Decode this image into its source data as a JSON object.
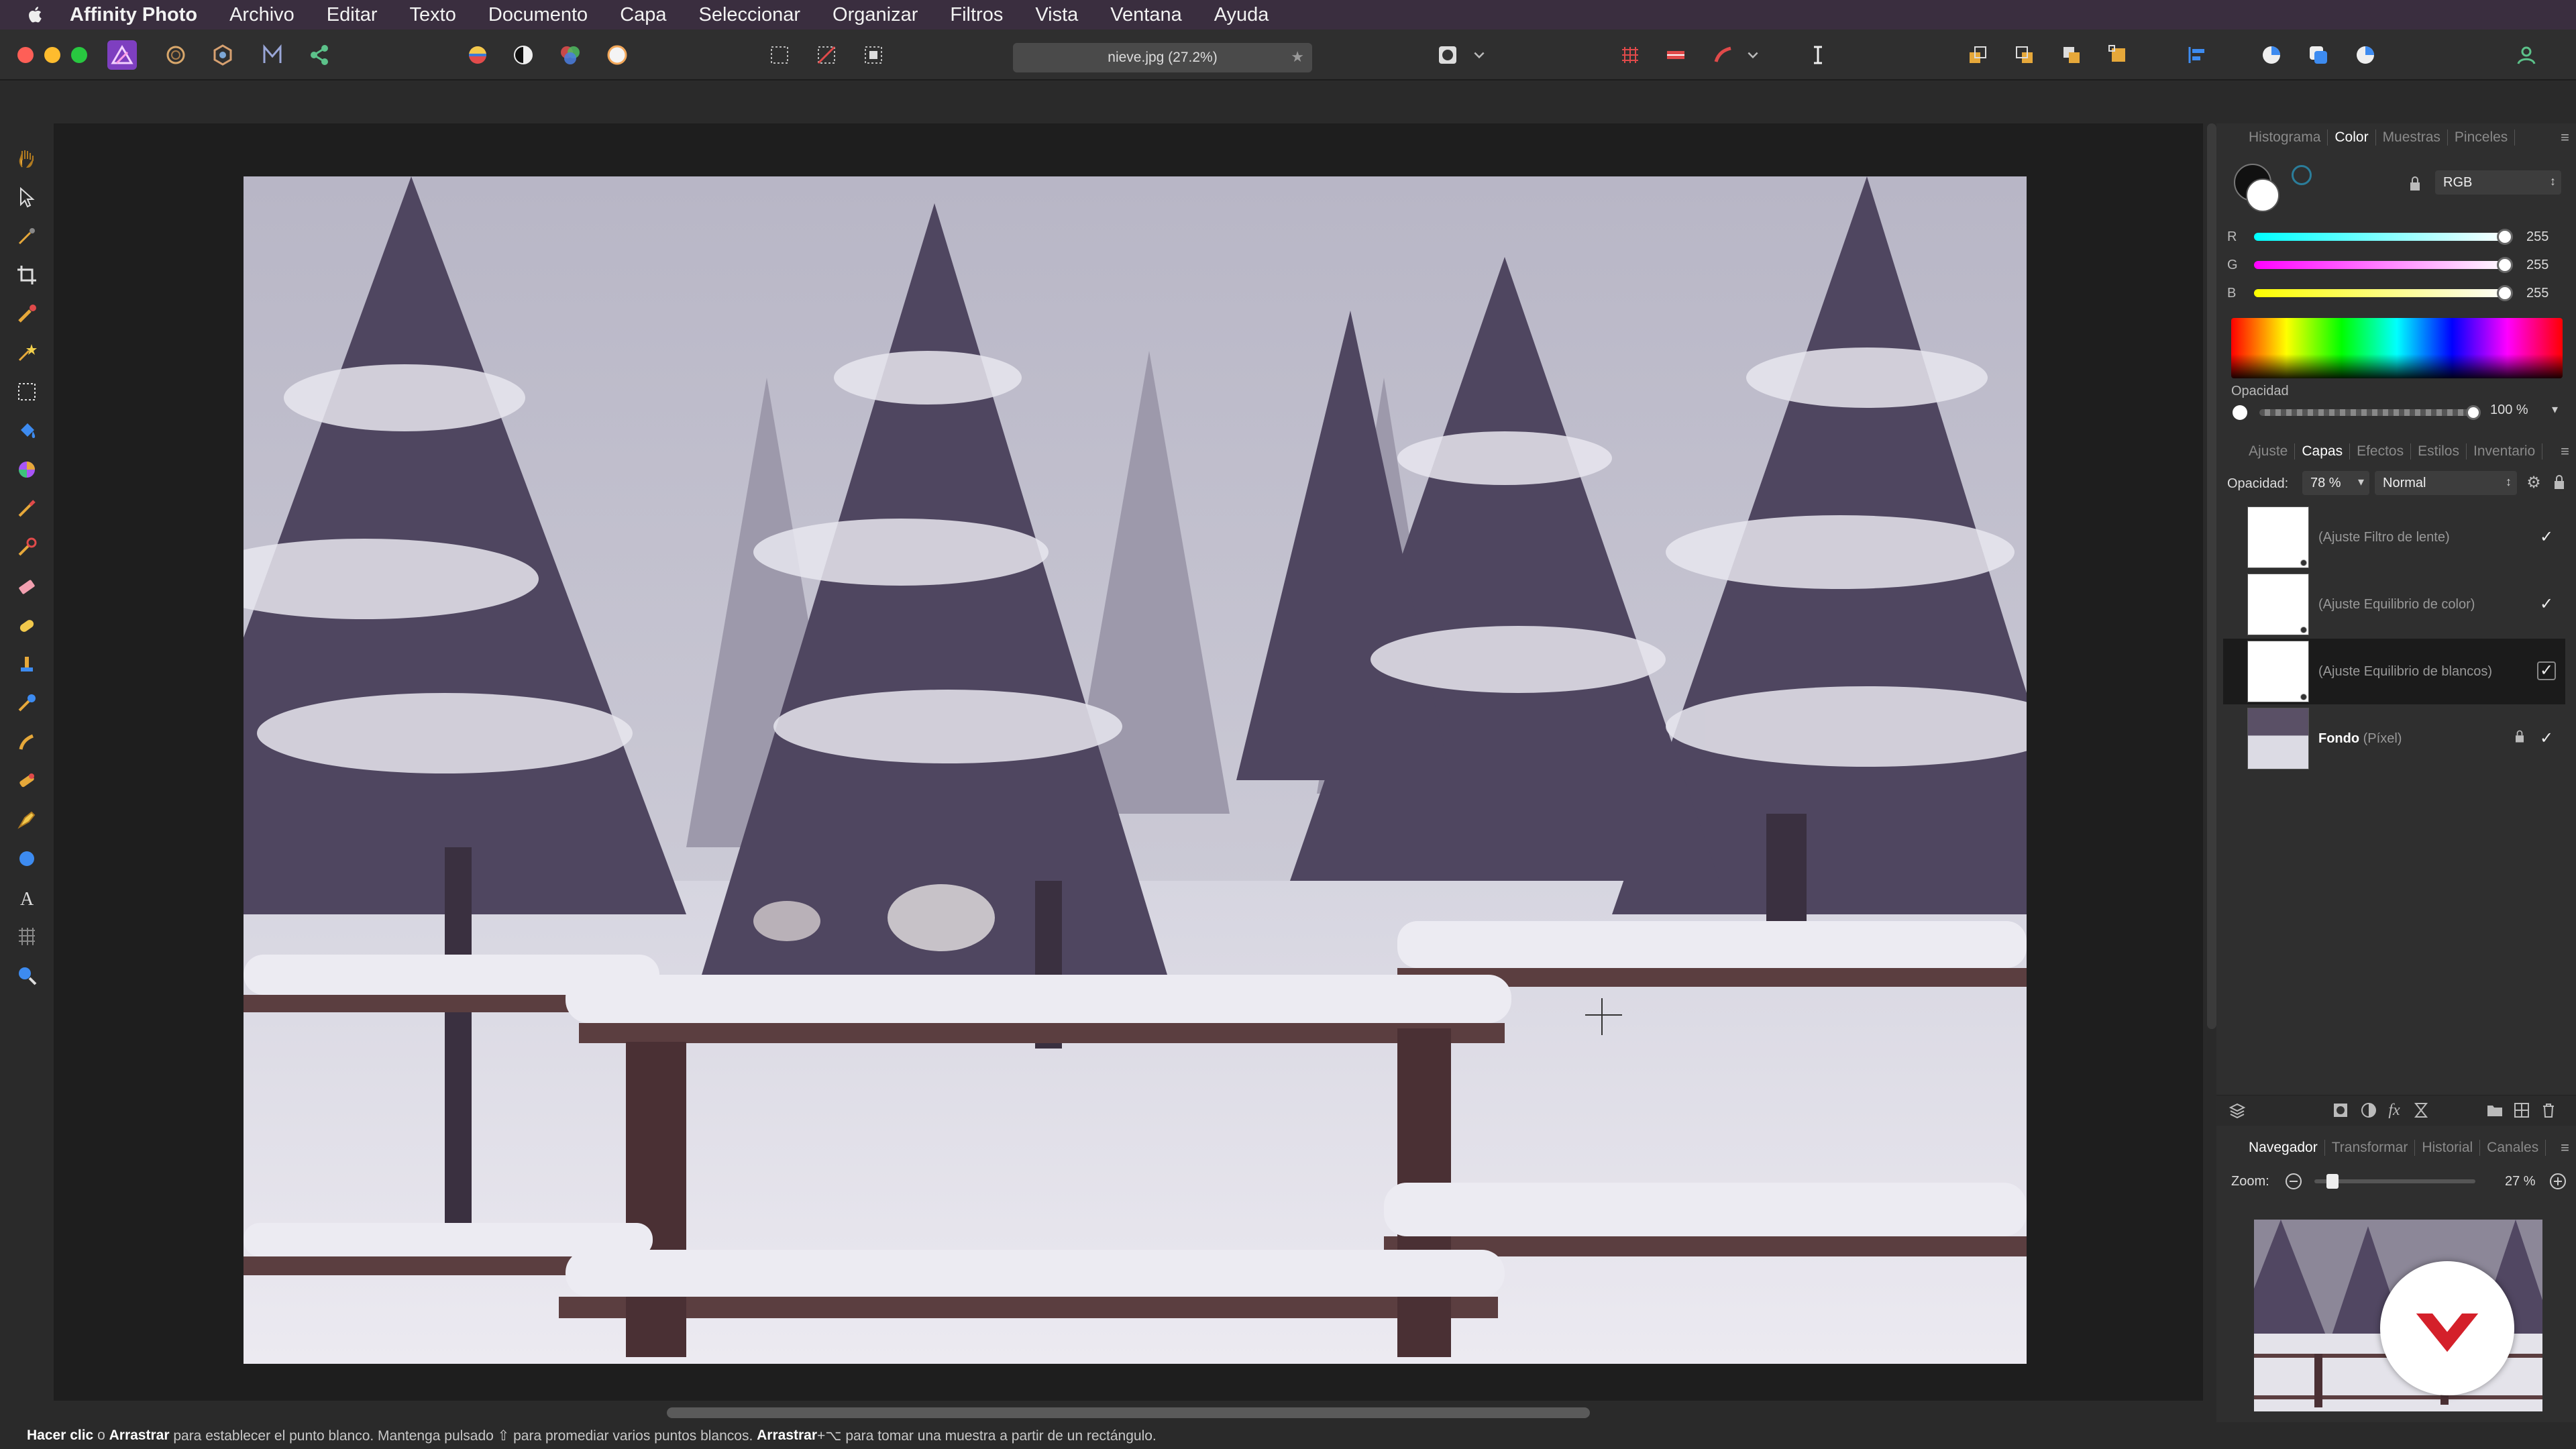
{
  "menubar": {
    "apple_icon": "apple-icon",
    "app_name": "Affinity Photo",
    "items": [
      "Archivo",
      "Editar",
      "Texto",
      "Documento",
      "Capa",
      "Seleccionar",
      "Organizar",
      "Filtros",
      "Vista",
      "Ventana",
      "Ayuda"
    ]
  },
  "toolbar": {
    "document_tab": "nieve.jpg (27.2%)",
    "document_tab_star": "★",
    "colors": {
      "accent": "#a855f7",
      "menubar": "#3a2e3f"
    }
  },
  "color_panel": {
    "tabs": [
      "Histograma",
      "Color",
      "Muestras",
      "Pinceles"
    ],
    "active_tab": "Color",
    "model": "RGB",
    "channels": [
      {
        "label": "R",
        "value": "255"
      },
      {
        "label": "G",
        "value": "255"
      },
      {
        "label": "B",
        "value": "255"
      }
    ],
    "opacity_label": "Opacidad",
    "opacity_value": "100 %"
  },
  "layers_panel": {
    "tabs": [
      "Ajuste",
      "Capas",
      "Efectos",
      "Estilos",
      "Inventario"
    ],
    "active_tab": "Capas",
    "opacity_label": "Opacidad:",
    "opacity_value": "78 %",
    "blend_mode": "Normal",
    "layers": [
      {
        "name": "(Ajuste Filtro de lente)",
        "check": "✓"
      },
      {
        "name": "(Ajuste Equilibrio de color)",
        "check": "✓"
      },
      {
        "name": "(Ajuste Equilibrio de blancos)",
        "check": "✓"
      },
      {
        "name_bold": "Fondo",
        "name_rest": " (Píxel)",
        "check": "✓"
      }
    ]
  },
  "navigator_panel": {
    "tabs": [
      "Navegador",
      "Transformar",
      "Historial",
      "Canales"
    ],
    "active_tab": "Navegador",
    "zoom_label": "Zoom:",
    "zoom_value": "27 %"
  },
  "statusbar": {
    "part1": "Hacer clic",
    "part2": " o ",
    "part3": "Arrastrar",
    "part4": " para establecer el punto blanco. Mantenga pulsado ⇧ para promediar varios puntos blancos. ",
    "part5": "Arrastrar",
    "part6": "+⌥ para tomar una muestra a partir de un rectángulo."
  }
}
